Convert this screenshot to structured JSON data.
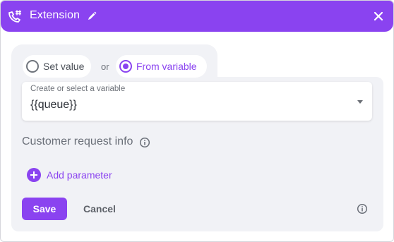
{
  "header": {
    "title": "Extension",
    "icon": "phone-hash-icon",
    "edit_icon": "pencil-icon",
    "close_icon": "close-icon",
    "color": "#8a43f0"
  },
  "mode": {
    "options": [
      {
        "label": "Set value",
        "selected": false
      },
      {
        "label": "From variable",
        "selected": true
      }
    ],
    "separator": "or"
  },
  "variable_select": {
    "label": "Create or select a variable",
    "value": "{{queue}}"
  },
  "customer_request": {
    "title": "Customer request info",
    "add_label": "Add parameter"
  },
  "actions": {
    "save_label": "Save",
    "cancel_label": "Cancel"
  }
}
